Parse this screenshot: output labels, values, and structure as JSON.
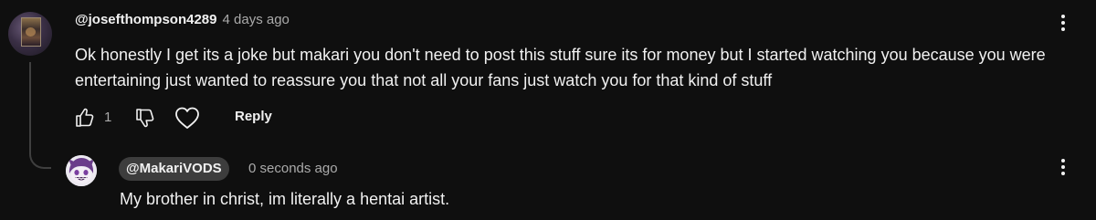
{
  "comment": {
    "author": "@josefthompson4289",
    "time": "4 days ago",
    "text": "Ok honestly I get its a joke but makari you don't need to post this stuff sure its for money but I started watching you because you were entertaining just wanted to reassure you that not all your fans just watch you for that kind of stuff",
    "like_count": "1",
    "reply_label": "Reply",
    "icons": {
      "like": "thumbs-up-icon",
      "dislike": "thumbs-down-icon",
      "heart": "heart-icon",
      "menu": "more-vert-icon"
    }
  },
  "reply": {
    "author": "@MakariVODS",
    "time": "0 seconds ago",
    "text": "My brother in christ, im literally a hentai artist.",
    "icons": {
      "menu": "more-vert-icon"
    }
  },
  "colors": {
    "background": "#0f0f0f",
    "primary_text": "#f1f1f1",
    "secondary_text": "#aaaaaa",
    "author_chip": "#3d3d3d",
    "thread_line": "#3f3f3f"
  }
}
